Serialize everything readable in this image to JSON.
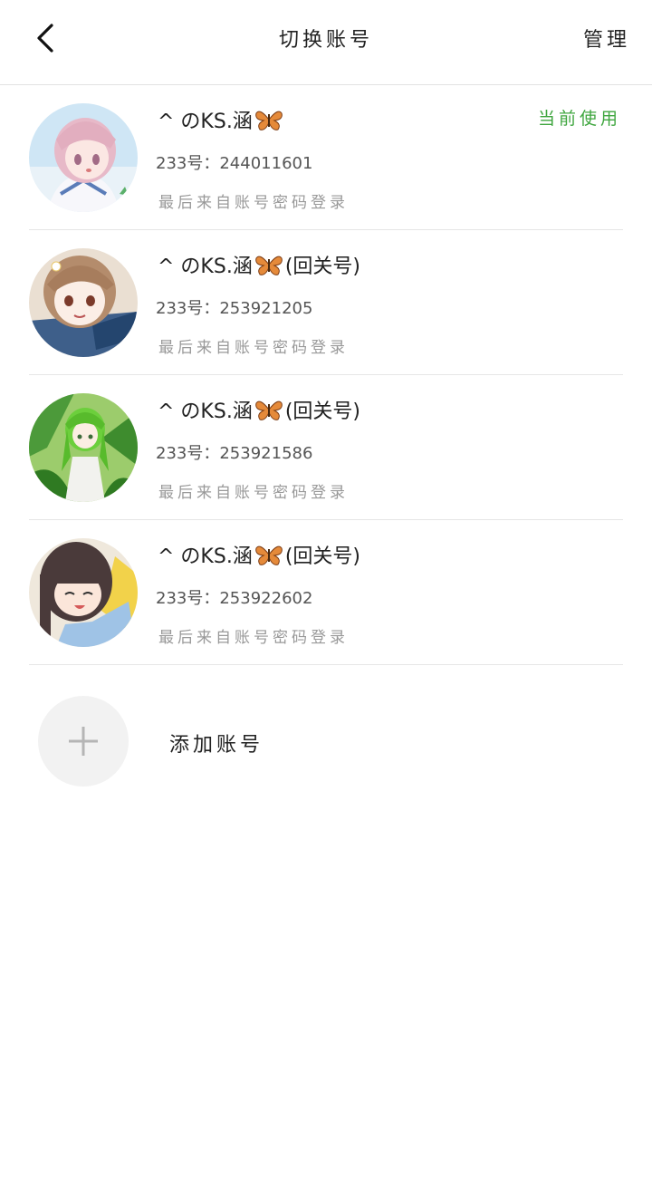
{
  "header": {
    "title": "切换账号",
    "manage_label": "管理",
    "back_icon": "chevron-left-icon"
  },
  "accounts": [
    {
      "name_prefix": "^ のKS.涵",
      "name_suffix": "",
      "uid_label": "233号：",
      "uid": "244011601",
      "login_info": "最后来自账号密码登录",
      "status": "当前使用",
      "avatar_palette": "pink-hair-anime-girl"
    },
    {
      "name_prefix": "^ のKS.涵",
      "name_suffix": "(回关号)",
      "uid_label": "233号：",
      "uid": "253921205",
      "login_info": "最后来自账号密码登录",
      "status": "",
      "avatar_palette": "brown-hair-anime-girl"
    },
    {
      "name_prefix": "^ のKS.涵",
      "name_suffix": "(回关号)",
      "uid_label": "233号：",
      "uid": "253921586",
      "login_info": "最后来自账号密码登录",
      "status": "",
      "avatar_palette": "green-hair-anime-girl"
    },
    {
      "name_prefix": "^ のKS.涵",
      "name_suffix": "(回关号)",
      "uid_label": "233号：",
      "uid": "253922602",
      "login_info": "最后来自账号密码登录",
      "status": "",
      "avatar_palette": "dark-hair-anime-girl"
    }
  ],
  "add_account": {
    "label": "添加账号",
    "icon": "plus-icon"
  },
  "colors": {
    "current_status": "#3fa63f",
    "secondary_text": "#999999",
    "divider": "#e6e6e6"
  }
}
